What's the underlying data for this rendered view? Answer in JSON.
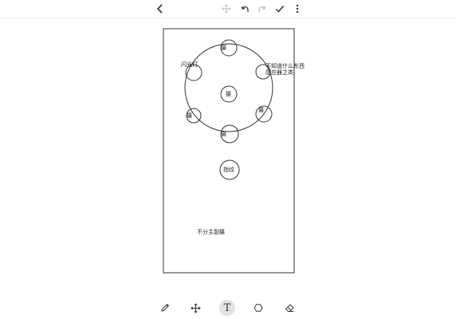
{
  "toolbar": {
    "back_icon": "chevron-left-icon",
    "move_icon": "move-arrows-icon",
    "undo_icon": "undo-icon",
    "redo_icon": "redo-icon",
    "confirm_icon": "check-icon",
    "more_icon": "more-vertical-icon"
  },
  "drawing": {
    "labels": {
      "flash": "闪光灯",
      "unknown_line1": "不知道什么东西",
      "unknown_line2": "感应器之类",
      "center": "摄",
      "cam_top": "摄",
      "cam_bottom": "摄",
      "cam_left": "摄",
      "cam_right": "摄",
      "fingerprint": "指纹",
      "note": "不分主副摄"
    }
  },
  "tools": [
    {
      "name": "pen",
      "icon": "pen-icon"
    },
    {
      "name": "move",
      "icon": "move-arrows-icon"
    },
    {
      "name": "text",
      "icon": "text-icon",
      "glyph": "T",
      "active": true
    },
    {
      "name": "shape",
      "icon": "hexagon-icon"
    },
    {
      "name": "eraser",
      "icon": "eraser-icon"
    }
  ],
  "colors": {
    "stroke": "#333333",
    "active_tool_bg": "#e2e2e2",
    "disabled_icon": "#bbbbbb"
  }
}
